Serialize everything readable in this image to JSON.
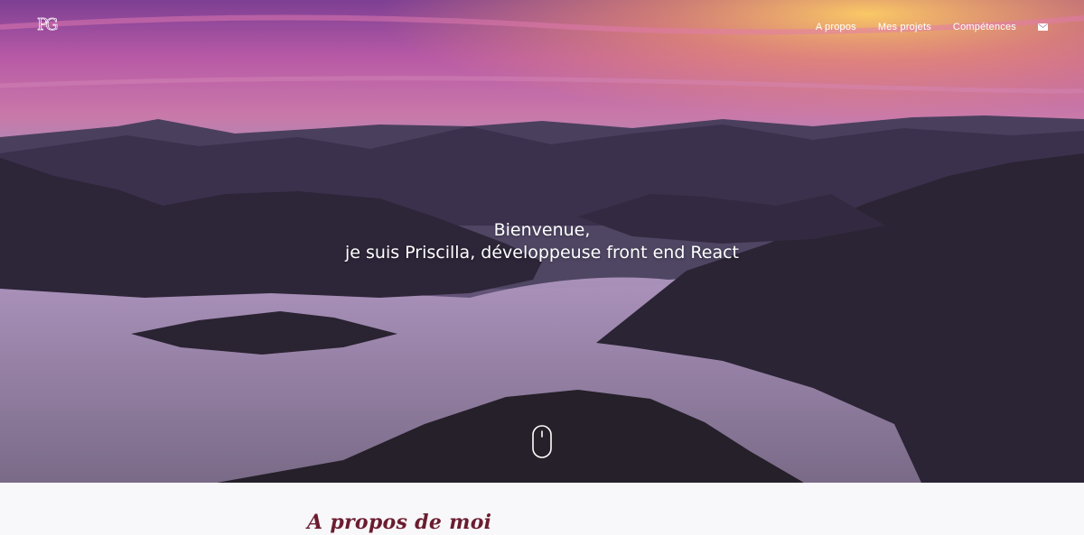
{
  "header": {
    "logo_text": "PG",
    "nav": [
      {
        "label": "A propos"
      },
      {
        "label": "Mes projets"
      },
      {
        "label": "Compétences"
      }
    ],
    "contact_icon": "mail-icon"
  },
  "hero": {
    "greeting": "Bienvenue,",
    "tagline": "je suis Priscilla, développeuse front end React",
    "scroll_icon": "mouse-scroll-icon"
  },
  "about": {
    "title": "A propos de moi"
  },
  "colors": {
    "about_title": "#6a1d2f",
    "sky_top": "#8e4aa0",
    "sky_glow": "#ffb347",
    "page_background": "#f8f7fa"
  }
}
